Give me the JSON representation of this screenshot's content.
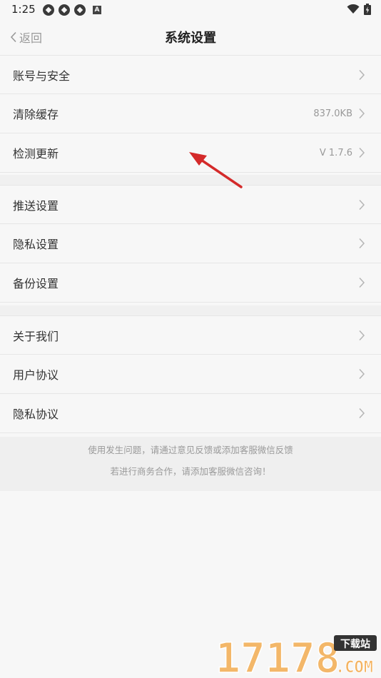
{
  "status_bar": {
    "time": "1:25",
    "left_icons": [
      "app-notification-icon",
      "app-notification-icon",
      "app-notification-icon",
      "a-badge-icon"
    ],
    "a_badge": "A",
    "right_icons": [
      "wifi-icon",
      "battery-charging-icon"
    ]
  },
  "nav": {
    "back_label": "返回",
    "title": "系统设置"
  },
  "groups": [
    {
      "items": [
        {
          "label": "账号与安全",
          "value": ""
        },
        {
          "label": "清除缓存",
          "value": "837.0KB"
        },
        {
          "label": "检测更新",
          "value": "V 1.7.6"
        }
      ]
    },
    {
      "items": [
        {
          "label": "推送设置",
          "value": ""
        },
        {
          "label": "隐私设置",
          "value": ""
        },
        {
          "label": "备份设置",
          "value": ""
        }
      ]
    },
    {
      "items": [
        {
          "label": "关于我们",
          "value": ""
        },
        {
          "label": "用户协议",
          "value": ""
        },
        {
          "label": "隐私协议",
          "value": ""
        }
      ]
    }
  ],
  "footer": {
    "line1": "使用发生问题，请通过意见反馈或添加客服微信反馈",
    "line2": "若进行商务合作，请添加客服微信咨询！"
  },
  "watermark": {
    "number": "17178",
    "badge": "下载站",
    "domain": ".COM"
  },
  "colors": {
    "background": "#f7f7f7",
    "annotation_arrow": "#d42a2a",
    "watermark_orange": "#f2a13a"
  }
}
